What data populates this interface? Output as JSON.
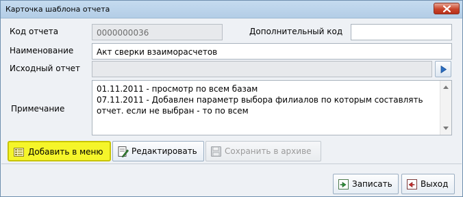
{
  "window": {
    "title": "Карточка шаблона отчета",
    "close_icon": "close-icon"
  },
  "form": {
    "report_code_label": "Код отчета",
    "report_code_value": "0000000036",
    "extra_code_label": "Дополнительный код",
    "extra_code_value": "",
    "name_label": "Наименование",
    "name_value": "Акт сверки взаиморасчетов",
    "source_report_label": "Исходный отчет",
    "source_report_value": "",
    "note_label": "Примечание",
    "note_lines": [
      "01.11.2011 - просмотр по всем базам",
      "07.11.2011 - Добавлен параметр выбора филиалов по которым составлять",
      "отчет. если не выбран - то по всем"
    ]
  },
  "actions": {
    "add_to_menu": "Добавить в меню",
    "edit": "Редактировать",
    "archive": "Сохранить в архиве"
  },
  "footer": {
    "save": "Записать",
    "exit": "Выход"
  },
  "colors": {
    "highlight": "#f5f52a",
    "titlebar": "#b3cde6",
    "close": "#c9452b"
  }
}
